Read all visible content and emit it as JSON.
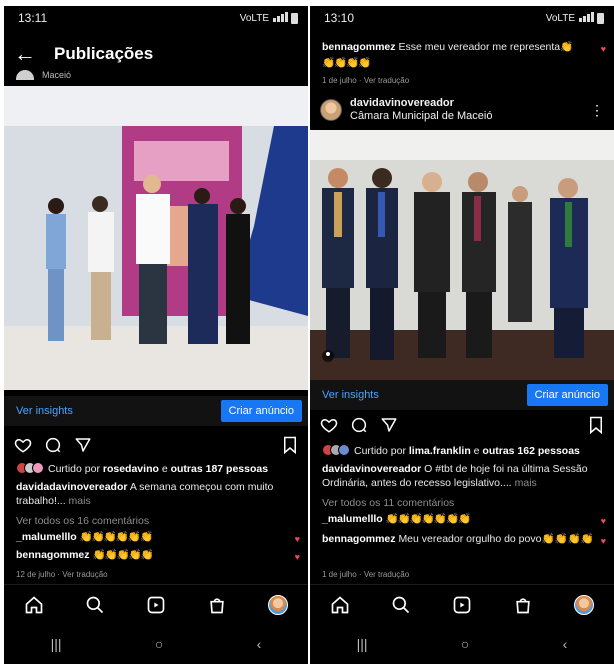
{
  "left": {
    "status": {
      "time": "13:11",
      "signal": "VoLTE"
    },
    "header": {
      "back_glyph": "←",
      "title": "Publicações"
    },
    "prev_post_location": "Maceió",
    "insights": {
      "link": "Ver insights",
      "cta": "Criar anúncio"
    },
    "likes": {
      "prefix": "Curtido por",
      "user": "rosedavino",
      "middle": "e",
      "others": "outras 187 pessoas"
    },
    "caption": {
      "user": "davidadavinovereador",
      "text": "A semana começou com muito trabalho!...",
      "more": "mais"
    },
    "view_comments": "Ver todos os 16 comentários",
    "comments": [
      {
        "user": "_malumelllo",
        "text": "👏👏👏👏👏👏"
      },
      {
        "user": "bennagommez",
        "text": "👏👏👏👏👏"
      }
    ],
    "date": "12 de julho",
    "translate": "Ver tradução"
  },
  "right": {
    "status": {
      "time": "13:10",
      "signal": "VoLTE"
    },
    "top_comment": {
      "user": "bennagommez",
      "text": "Esse meu vereador me representa👏",
      "emojis": "👏👏👏👏",
      "date": "1 de julho",
      "translate": "Ver tradução"
    },
    "post": {
      "user": "davidavinovereador",
      "location": "Câmara Municipal de Maceió",
      "more": "⋮"
    },
    "insights": {
      "link": "Ver insights",
      "cta": "Criar anúncio"
    },
    "likes": {
      "prefix": "Curtido por",
      "user": "lima.franklin",
      "middle": "e",
      "others": "outras 162 pessoas"
    },
    "caption": {
      "user": "davidavinovereador",
      "text": "O #tbt de hoje foi na última Sessão Ordinária, antes do recesso legislativo....",
      "more": "mais"
    },
    "view_comments": "Ver todos os 11 comentários",
    "comments": [
      {
        "user": "_malumelllo",
        "text": "👏👏👏👏👏👏👏"
      },
      {
        "user": "bennagommez",
        "text": "Meu vereador orgulho do povo👏👏👏👏"
      }
    ],
    "date": "1 de julho",
    "translate": "Ver tradução"
  },
  "colors": {
    "background": "#000000",
    "link": "#4aa3ff",
    "cta": "#1877f2",
    "heart": "#ed4956"
  },
  "icons": [
    "back-arrow-icon",
    "heart-icon",
    "comment-icon",
    "share-icon",
    "bookmark-icon",
    "home-icon",
    "search-icon",
    "reels-icon",
    "shop-icon",
    "profile-avatar",
    "more-icon"
  ]
}
